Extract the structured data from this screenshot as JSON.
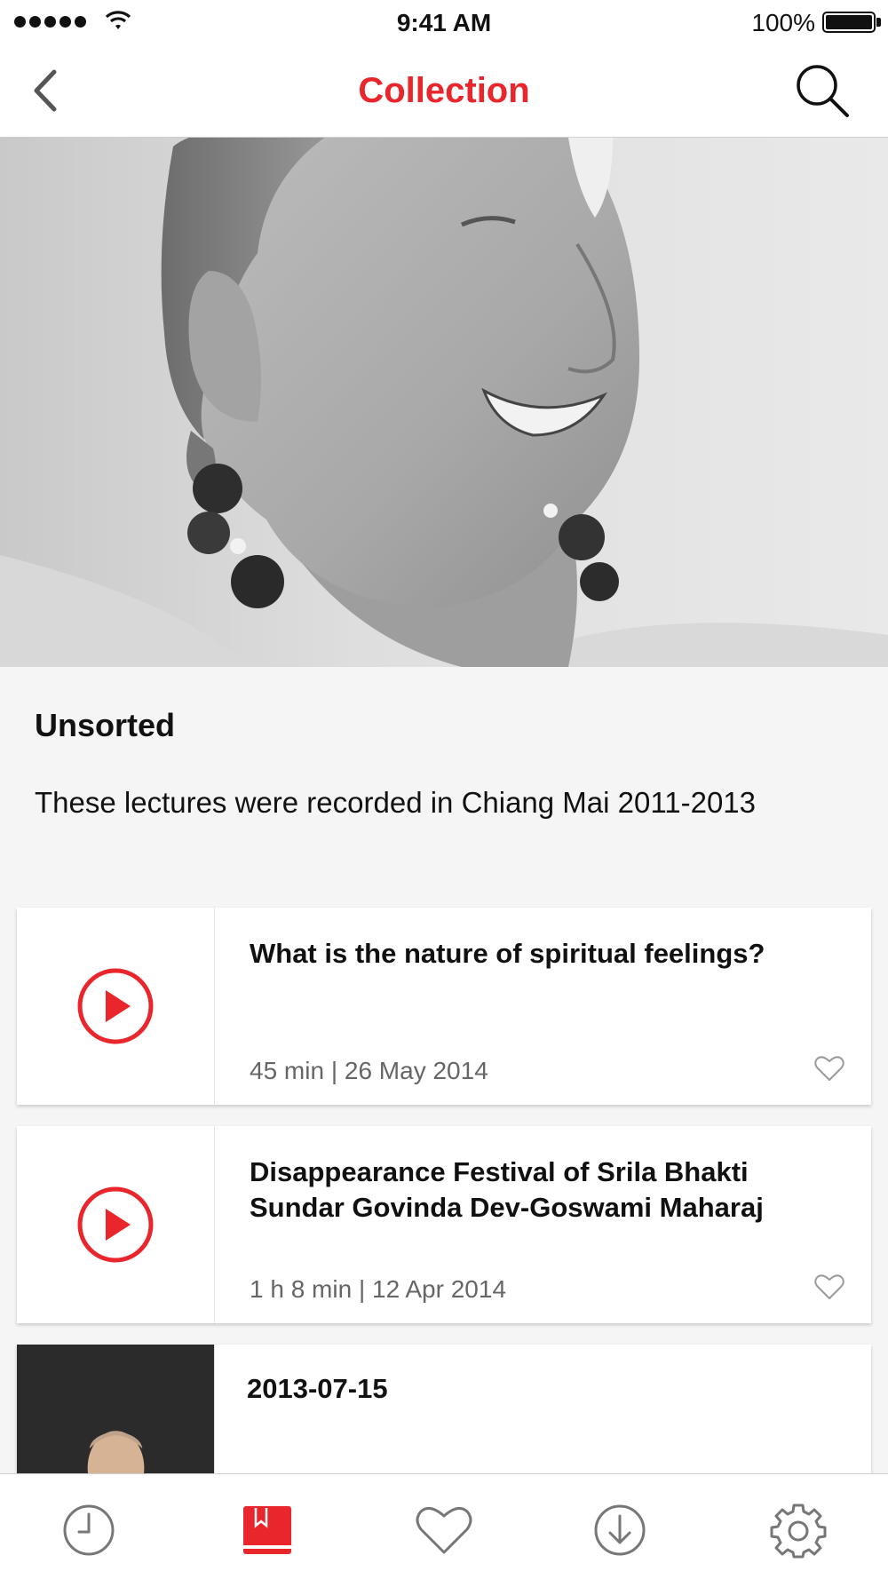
{
  "status_bar": {
    "time": "9:41 AM",
    "battery": "100%"
  },
  "nav": {
    "title": "Collection"
  },
  "collection": {
    "title": "Unsorted",
    "description": "These lectures were recorded in Chiang Mai 2011-2013"
  },
  "lectures": [
    {
      "title": "What is the nature of spiritual feelings?",
      "meta": "45 min | 26 May 2014"
    },
    {
      "title": "Disappearance Festival of Srila Bhakti Sundar Govinda Dev-Goswami Maharaj",
      "meta": "1 h 8 min | 12 Apr 2014"
    },
    {
      "title": "2013-07-15",
      "meta": ""
    }
  ],
  "tabs": [
    {
      "icon": "clock-icon"
    },
    {
      "icon": "bookmark-book-icon",
      "active": true
    },
    {
      "icon": "heart-icon"
    },
    {
      "icon": "download-icon"
    },
    {
      "icon": "gear-icon"
    }
  ],
  "colors": {
    "accent": "#e8262b",
    "text": "#111111",
    "muted": "#666666",
    "background": "#f5f5f5"
  }
}
